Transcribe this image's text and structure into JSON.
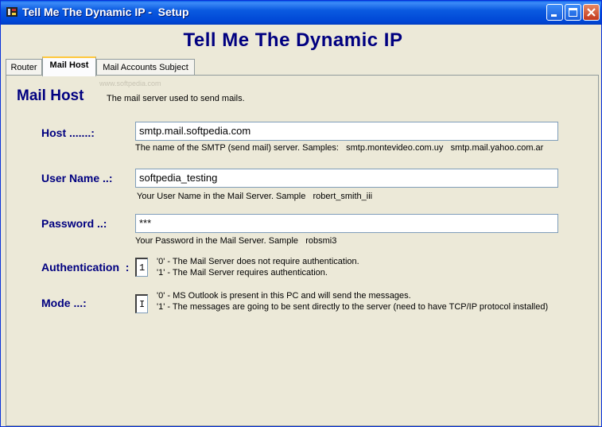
{
  "window": {
    "title": "Tell Me The Dynamic IP -  Setup",
    "buttons": {
      "minimize": "minimize",
      "maximize": "maximize",
      "close": "close"
    }
  },
  "app": {
    "heading": "Tell Me The Dynamic IP"
  },
  "tabs": [
    {
      "label": "Router",
      "active": false
    },
    {
      "label": "Mail Host",
      "active": true
    },
    {
      "label": "Mail Accounts  Subject",
      "active": false
    }
  ],
  "watermark": "www.softpedia.com",
  "section": {
    "title": "Mail Host",
    "description": "The mail server used to send mails."
  },
  "fields": {
    "host": {
      "label": "Host .......:",
      "value": "smtp.mail.softpedia.com",
      "hint": "The name of the SMTP (send mail) server. Samples:   smtp.montevideo.com.uy   smtp.mail.yahoo.com.ar"
    },
    "username": {
      "label": "User Name ..:",
      "value": "softpedia_testing",
      "hint": "Your User Name in the Mail Server. Sample   robert_smith_iii"
    },
    "password": {
      "label": "Password ..:",
      "value": "***",
      "hint": "Your Password in the Mail Server. Sample   robsmi3"
    },
    "authentication": {
      "label": "Authentication  :",
      "value": "1",
      "hint_line1": "'0' - The Mail Server does not require authentication.",
      "hint_line2": "'1' - The Mail Server requires authentication."
    },
    "mode": {
      "label": "Mode ...:",
      "value": "I",
      "hint_line1": "'0' - MS Outlook is present in this PC and will send the messages.",
      "hint_line2": "'1' - The messages are going to be sent directly to the server (need to have TCP/IP protocol installed)"
    }
  },
  "colors": {
    "label": "#000080",
    "titlebar": "#0A5AE0",
    "background": "#ECE9D8"
  }
}
